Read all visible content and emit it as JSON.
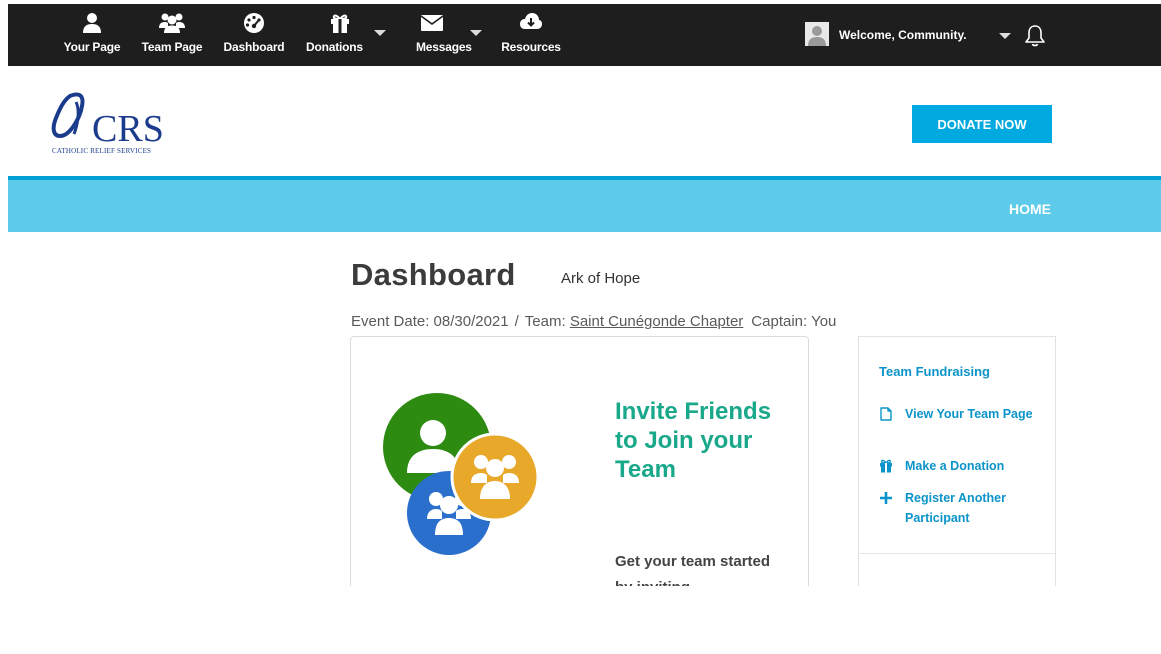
{
  "topnav": {
    "items": [
      {
        "label": "Your Page",
        "icon": "person-icon"
      },
      {
        "label": "Team Page",
        "icon": "group-icon"
      },
      {
        "label": "Dashboard",
        "icon": "dashboard-gauge-icon"
      },
      {
        "label": "Donations",
        "icon": "gift-icon"
      },
      {
        "label": "Messages",
        "icon": "envelope-icon"
      },
      {
        "label": "Resources",
        "icon": "cloud-download-icon"
      }
    ],
    "welcome": "Welcome, Community.",
    "bell_icon": "bell-icon"
  },
  "header": {
    "logo_text": "CRS",
    "logo_subtext": "CATHOLIC RELIEF SERVICES",
    "donate_label": "DONATE NOW"
  },
  "band": {
    "home_label": "HOME"
  },
  "main": {
    "title": "Dashboard",
    "subtitle": "Ark of Hope",
    "event_label": "Event Date: 08/30/2021",
    "separator": "/",
    "team_label": "Team:",
    "team_name": "Saint Cunégonde Chapter",
    "captain": "Captain: You"
  },
  "invite_card": {
    "title": "Invite Friends to Join your Team",
    "body": "Get your team started by inviting"
  },
  "side_panel": {
    "heading": "Team Fundraising",
    "links": [
      {
        "label": "View Your Team Page",
        "icon": "page-icon"
      },
      {
        "label": "Make a Donation",
        "icon": "gift-icon"
      },
      {
        "label": "Register Another Participant",
        "icon": "plus-icon"
      }
    ]
  },
  "colors": {
    "topbar": "#1e1e1e",
    "accent_blue": "#00a9e0",
    "band": "#5ecbea",
    "invite_green": "#1aa88a",
    "link_blue": "#0b94c9",
    "circle_green": "#2e8b12",
    "circle_orange": "#e8a82a",
    "circle_blue": "#2a6fcb"
  }
}
